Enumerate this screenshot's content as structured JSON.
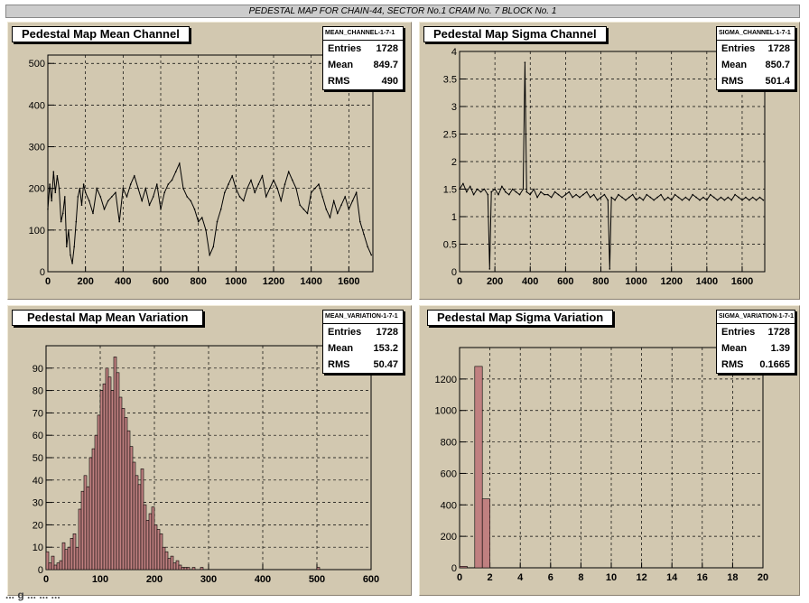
{
  "page_title": "PEDESTAL MAP FOR CHAIN-44, SECTOR No.1 CRAM No. 7 BLOCK No. 1",
  "footer_text": "... g ... ... ...",
  "colors": {
    "pad_bg": "#d2c8b0",
    "hist_fill": "#c08080",
    "grid": "#000000"
  },
  "panels": [
    {
      "title": "Pedestal Map Mean Channel",
      "stats": {
        "name": "MEAN_CHANNEL-1-7-1",
        "entries": "1728",
        "mean": "849.7",
        "rms": "490"
      }
    },
    {
      "title": "Pedestal Map Sigma Channel",
      "stats": {
        "name": "SIGMA_CHANNEL-1-7-1",
        "entries": "1728",
        "mean": "850.7",
        "rms": "501.4"
      }
    },
    {
      "title": "Pedestal Map Mean Variation",
      "stats": {
        "name": "MEAN_VARIATION-1-7-1",
        "entries": "1728",
        "mean": "153.2",
        "rms": "50.47"
      }
    },
    {
      "title": "Pedestal Map Sigma Variation",
      "stats": {
        "name": "SIGMA_VARIATION-1-7-1",
        "entries": "1728",
        "mean": "1.39",
        "rms": "0.1665"
      }
    }
  ],
  "stat_labels": {
    "entries": "Entries",
    "mean": "Mean",
    "rms": "RMS"
  },
  "chart_data": [
    {
      "type": "line",
      "title": "Pedestal Map Mean Channel",
      "xlim": [
        0,
        1728
      ],
      "ylim": [
        0,
        520
      ],
      "xticks": [
        0,
        200,
        400,
        600,
        800,
        1000,
        1200,
        1400,
        1600
      ],
      "yticks": [
        0,
        100,
        200,
        300,
        400,
        500
      ],
      "grid": true,
      "x": [
        0,
        10,
        20,
        30,
        40,
        50,
        60,
        70,
        80,
        90,
        100,
        110,
        120,
        130,
        140,
        150,
        160,
        170,
        180,
        190,
        200,
        220,
        240,
        260,
        280,
        300,
        320,
        340,
        360,
        380,
        400,
        420,
        440,
        460,
        480,
        500,
        520,
        540,
        560,
        580,
        600,
        620,
        640,
        660,
        680,
        700,
        720,
        740,
        760,
        780,
        800,
        820,
        840,
        860,
        880,
        900,
        920,
        940,
        960,
        980,
        1000,
        1020,
        1040,
        1060,
        1080,
        1100,
        1120,
        1140,
        1160,
        1180,
        1200,
        1220,
        1240,
        1260,
        1280,
        1300,
        1320,
        1340,
        1360,
        1380,
        1400,
        1420,
        1440,
        1460,
        1480,
        1500,
        1520,
        1540,
        1560,
        1580,
        1600,
        1620,
        1640,
        1660,
        1680,
        1700,
        1720
      ],
      "values": [
        150,
        210,
        170,
        240,
        190,
        230,
        200,
        120,
        140,
        180,
        60,
        100,
        40,
        20,
        60,
        120,
        180,
        200,
        160,
        210,
        190,
        170,
        140,
        200,
        180,
        150,
        170,
        180,
        190,
        120,
        200,
        180,
        210,
        230,
        200,
        170,
        200,
        160,
        180,
        210,
        150,
        190,
        210,
        220,
        240,
        260,
        200,
        180,
        170,
        150,
        120,
        130,
        100,
        40,
        60,
        120,
        150,
        190,
        210,
        230,
        200,
        180,
        170,
        200,
        220,
        190,
        210,
        230,
        180,
        200,
        220,
        200,
        170,
        210,
        240,
        220,
        200,
        160,
        150,
        140,
        190,
        200,
        210,
        180,
        150,
        130,
        170,
        140,
        160,
        180,
        150,
        170,
        190,
        120,
        90,
        60,
        40
      ]
    },
    {
      "type": "line",
      "title": "Pedestal Map Sigma Channel",
      "xlim": [
        0,
        1728
      ],
      "ylim": [
        0,
        4
      ],
      "xticks": [
        0,
        200,
        400,
        600,
        800,
        1000,
        1200,
        1400,
        1600
      ],
      "yticks": [
        0,
        0.5,
        1,
        1.5,
        2,
        2.5,
        3,
        3.5,
        4
      ],
      "grid": true,
      "x": [
        0,
        20,
        40,
        60,
        80,
        100,
        120,
        140,
        160,
        170,
        180,
        200,
        220,
        240,
        260,
        280,
        300,
        320,
        340,
        360,
        370,
        380,
        400,
        420,
        440,
        460,
        480,
        500,
        520,
        540,
        560,
        580,
        600,
        620,
        640,
        660,
        680,
        700,
        720,
        740,
        760,
        780,
        800,
        820,
        840,
        850,
        860,
        880,
        900,
        920,
        940,
        960,
        980,
        1000,
        1020,
        1040,
        1060,
        1080,
        1100,
        1120,
        1140,
        1160,
        1180,
        1200,
        1220,
        1240,
        1260,
        1280,
        1300,
        1320,
        1340,
        1360,
        1380,
        1400,
        1420,
        1440,
        1460,
        1480,
        1500,
        1520,
        1540,
        1560,
        1580,
        1600,
        1620,
        1640,
        1660,
        1680,
        1700,
        1720
      ],
      "values": [
        1.5,
        1.6,
        1.45,
        1.55,
        1.4,
        1.5,
        1.45,
        1.5,
        1.4,
        0.05,
        1.45,
        1.5,
        1.4,
        1.55,
        1.45,
        1.4,
        1.5,
        1.45,
        1.4,
        1.5,
        3.8,
        1.45,
        1.4,
        1.5,
        1.35,
        1.45,
        1.4,
        1.4,
        1.35,
        1.45,
        1.4,
        1.35,
        1.4,
        1.45,
        1.35,
        1.4,
        1.35,
        1.4,
        1.45,
        1.35,
        1.4,
        1.3,
        1.35,
        1.4,
        1.3,
        0.05,
        1.35,
        1.3,
        1.4,
        1.35,
        1.3,
        1.35,
        1.4,
        1.3,
        1.35,
        1.3,
        1.4,
        1.35,
        1.3,
        1.35,
        1.4,
        1.3,
        1.35,
        1.3,
        1.4,
        1.35,
        1.3,
        1.35,
        1.3,
        1.4,
        1.35,
        1.3,
        1.35,
        1.3,
        1.4,
        1.35,
        1.3,
        1.35,
        1.3,
        1.35,
        1.3,
        1.4,
        1.35,
        1.3,
        1.35,
        1.3,
        1.35,
        1.3,
        1.35,
        1.3
      ]
    },
    {
      "type": "bar",
      "title": "Pedestal Map Mean Variation",
      "xlim": [
        0,
        600
      ],
      "ylim": [
        0,
        100
      ],
      "xticks": [
        0,
        100,
        200,
        300,
        400,
        500,
        600
      ],
      "yticks": [
        0,
        10,
        20,
        30,
        40,
        50,
        60,
        70,
        80,
        90
      ],
      "grid": true,
      "bin_width": 5,
      "x": [
        0,
        5,
        10,
        15,
        20,
        25,
        30,
        35,
        40,
        45,
        50,
        55,
        60,
        65,
        70,
        75,
        80,
        85,
        90,
        95,
        100,
        105,
        110,
        115,
        120,
        125,
        130,
        135,
        140,
        145,
        150,
        155,
        160,
        165,
        170,
        175,
        180,
        185,
        190,
        195,
        200,
        205,
        210,
        215,
        220,
        225,
        230,
        235,
        240,
        245,
        250,
        255,
        260,
        265,
        270,
        275,
        280,
        285,
        500,
        505
      ],
      "values": [
        8,
        3,
        6,
        2,
        3,
        4,
        12,
        9,
        10,
        14,
        16,
        10,
        27,
        35,
        42,
        37,
        50,
        54,
        60,
        69,
        80,
        83,
        90,
        86,
        80,
        95,
        88,
        77,
        72,
        68,
        62,
        55,
        48,
        42,
        38,
        45,
        29,
        22,
        25,
        28,
        20,
        18,
        16,
        10,
        8,
        5,
        6,
        3,
        4,
        2,
        1,
        1,
        1,
        0,
        1,
        0,
        0,
        1,
        1,
        0
      ]
    },
    {
      "type": "bar",
      "title": "Pedestal Map Sigma Variation",
      "xlim": [
        0,
        20
      ],
      "ylim": [
        0,
        1400
      ],
      "xticks": [
        0,
        2,
        4,
        6,
        8,
        10,
        12,
        14,
        16,
        18,
        20
      ],
      "yticks": [
        0,
        200,
        400,
        600,
        800,
        1000,
        1200
      ],
      "grid": true,
      "bin_width": 0.5,
      "x": [
        0,
        0.5,
        1.0,
        1.5
      ],
      "values": [
        10,
        0,
        1280,
        438
      ]
    }
  ]
}
